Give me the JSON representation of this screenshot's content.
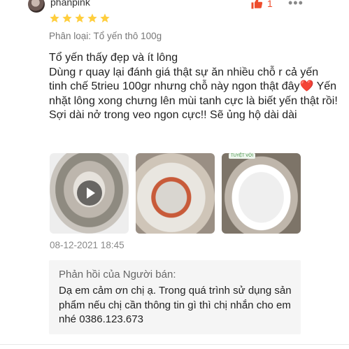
{
  "user": {
    "name": "phanpink"
  },
  "likes": {
    "count": "1"
  },
  "rating": {
    "stars": 5,
    "max": 5,
    "color": "#ffce3d"
  },
  "variant": {
    "text": "Phân loại: Tổ yến thô 100g"
  },
  "review": {
    "line1": "Tổ yến thấy đẹp và ít lông",
    "line2": "Dùng r quay lại đánh giá thật sự ăn nhiều chỗ r cả yến tinh chế 5trieu 100gr nhưng chỗ này ngon thật đây",
    "heart": "❤️",
    "line3": " Yến nhặt lông xong chưng lên mùi tanh cực là biết yến thật rồi! Sợi dài nở trong veo ngon cực!! Sẽ ủng hộ dài dài"
  },
  "media": {
    "badge": "TUYỆT VỜI"
  },
  "timestamp": "08-12-2021 18:45",
  "seller_reply": {
    "title": "Phản hồi của Người bán:",
    "text": "Dạ em cảm ơn chị ạ. Trong quá trình sử dụng sản phẩm nếu chị cần thông tin gì thì chị nhắn cho em nhé 0386.123.673"
  },
  "colors": {
    "accent": "#ee4d2d",
    "muted": "#888888",
    "reply_bg": "#f5f5f5"
  },
  "icons": {
    "like": "thumbs-up-icon",
    "more": "more-dots-icon",
    "play": "play-icon",
    "star": "star-icon"
  }
}
